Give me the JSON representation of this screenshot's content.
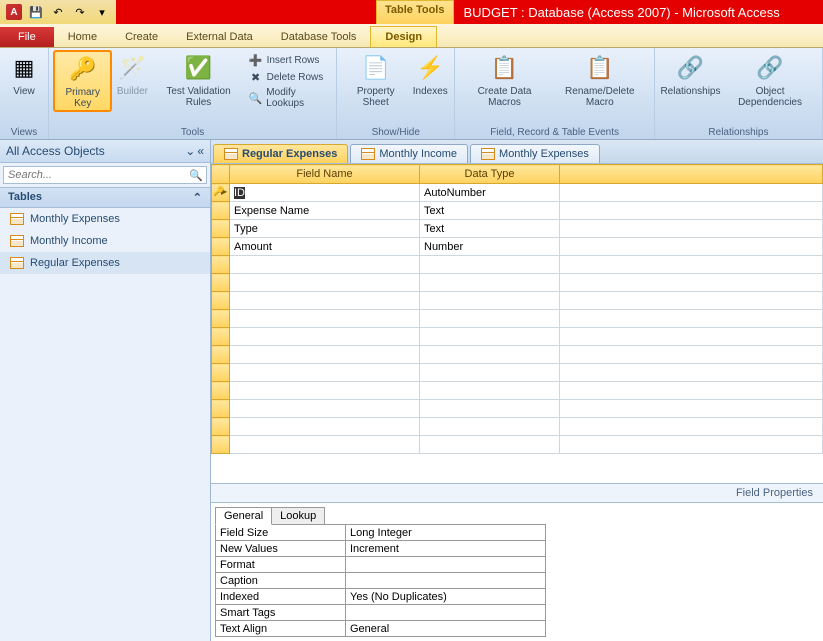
{
  "title": "BUDGET : Database (Access 2007) - Microsoft Access",
  "contextual_tab": "Table Tools",
  "tabs": {
    "file": "File",
    "home": "Home",
    "create": "Create",
    "external": "External Data",
    "dbtools": "Database Tools",
    "design": "Design"
  },
  "ribbon": {
    "views": {
      "view": "View",
      "label": "Views"
    },
    "tools": {
      "primary": "Primary Key",
      "builder": "Builder",
      "test": "Test Validation Rules",
      "insert": "Insert Rows",
      "delete": "Delete Rows",
      "modify": "Modify Lookups",
      "label": "Tools"
    },
    "showhide": {
      "prop": "Property Sheet",
      "indexes": "Indexes",
      "label": "Show/Hide"
    },
    "events": {
      "create": "Create Data Macros",
      "rename": "Rename/Delete Macro",
      "label": "Field, Record & Table Events"
    },
    "rel": {
      "rel": "Relationships",
      "obj": "Object Dependencies",
      "label": "Relationships"
    }
  },
  "nav": {
    "title": "All Access Objects",
    "search": "Search...",
    "group": "Tables",
    "items": [
      "Monthly Expenses",
      "Monthly Income",
      "Regular Expenses"
    ]
  },
  "dtabs": [
    "Regular Expenses",
    "Monthly Income",
    "Monthly Expenses"
  ],
  "columns": [
    "Field Name",
    "Data Type"
  ],
  "rows": [
    {
      "name": "ID",
      "type": "AutoNumber",
      "key": true
    },
    {
      "name": "Expense Name",
      "type": "Text"
    },
    {
      "name": "Type",
      "type": "Text"
    },
    {
      "name": "Amount",
      "type": "Number"
    }
  ],
  "props_label": "Field Properties",
  "proptabs": [
    "General",
    "Lookup"
  ],
  "props": [
    {
      "k": "Field Size",
      "v": "Long Integer"
    },
    {
      "k": "New Values",
      "v": "Increment"
    },
    {
      "k": "Format",
      "v": ""
    },
    {
      "k": "Caption",
      "v": ""
    },
    {
      "k": "Indexed",
      "v": "Yes (No Duplicates)"
    },
    {
      "k": "Smart Tags",
      "v": ""
    },
    {
      "k": "Text Align",
      "v": "General"
    }
  ]
}
